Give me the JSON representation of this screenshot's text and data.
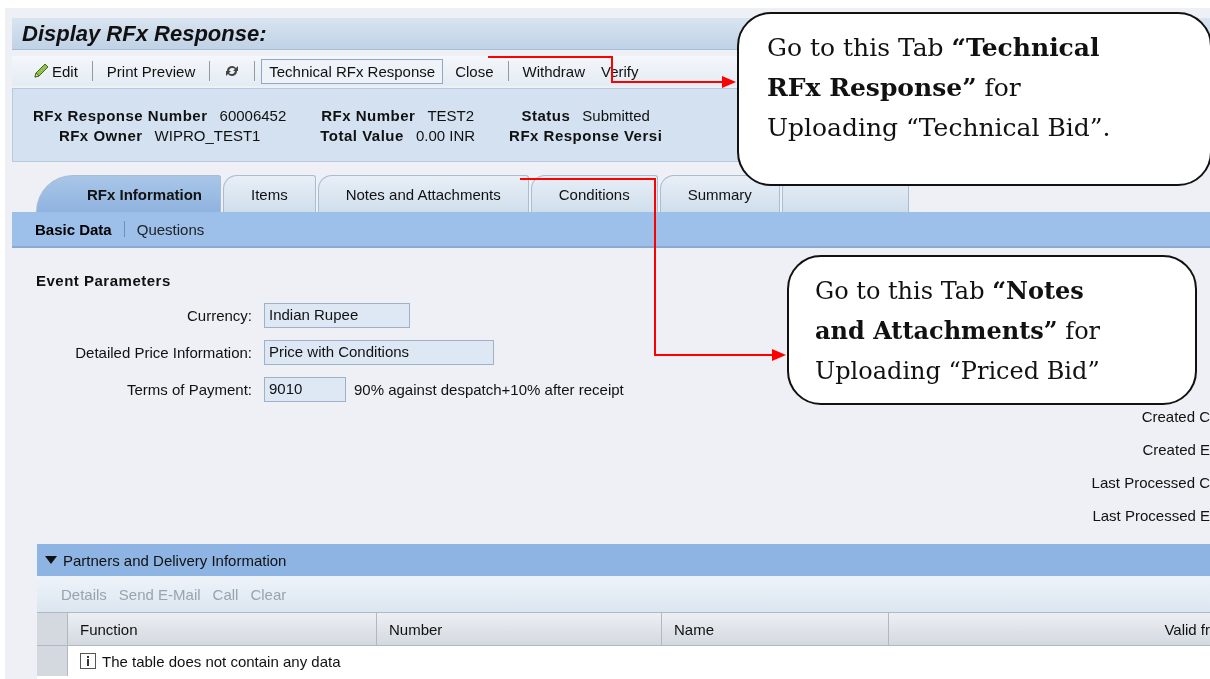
{
  "window": {
    "title": "Display RFx Response:"
  },
  "toolbar": [
    {
      "kind": "edit",
      "label": "Edit",
      "separator_after": true
    },
    {
      "kind": "text",
      "label": "Print Preview",
      "separator_after": true
    },
    {
      "kind": "refresh",
      "separator_after": true
    },
    {
      "kind": "framed",
      "label": "Technical RFx Response",
      "separator_after": false
    },
    {
      "kind": "text",
      "label": "Close",
      "separator_after": true
    },
    {
      "kind": "text",
      "label": "Withdraw",
      "separator_after": false
    },
    {
      "kind": "text",
      "label": "Verify",
      "separator_after": false
    }
  ],
  "header": [
    [
      {
        "label": "RFx Response Number",
        "value": "60006452"
      },
      {
        "label": "RFx Owner",
        "value": "WIPRO_TEST1"
      }
    ],
    [
      {
        "label": "RFx Number",
        "value": "TEST2"
      },
      {
        "label": "Total Value",
        "value": "0.00 INR"
      }
    ],
    [
      {
        "label": "Status",
        "value": "Submitted"
      },
      {
        "label": "RFx Response Versi"
      }
    ]
  ],
  "tabs": [
    {
      "label": "RFx Information",
      "selected": true
    },
    {
      "label": "Items",
      "selected": false
    },
    {
      "label": "Notes and Attachments",
      "selected": false
    },
    {
      "label": "Conditions",
      "selected": false
    },
    {
      "label": "Summary",
      "selected": false
    },
    {
      "selected": false
    }
  ],
  "subtabs": [
    {
      "label": "Basic Data",
      "selected": true
    },
    {
      "label": "Questions",
      "selected": false
    }
  ],
  "event_parameters": {
    "title": "Event Parameters",
    "fields": [
      {
        "label": "Currency:",
        "value": "Indian Rupee"
      },
      {
        "label": "Detailed Price Information:",
        "value": "Price with Conditions"
      },
      {
        "label": "Terms of Payment:",
        "value": "9010",
        "description": "90% against despatch+10% after receipt"
      }
    ]
  },
  "right_labels": [
    "Created C",
    "Created E",
    "Last Processed C",
    "Last Processed E"
  ],
  "partners": {
    "title": "Partners and Delivery Information",
    "expanded": true,
    "actions": [
      {
        "label": "Details",
        "disabled": true
      },
      {
        "label": "Send E-Mail",
        "disabled": true
      },
      {
        "label": "Call",
        "disabled": true
      },
      {
        "label": "Clear",
        "disabled": true
      }
    ],
    "columns": [
      "Function",
      "Number",
      "Name",
      "Valid fr"
    ],
    "empty_message": "The table does not contain any data"
  },
  "callouts": [
    {
      "text": "Go to this Tab **“Technical RFx Response”** for Uploading “Technical Bid”."
    },
    {
      "text": "Go to this Tab **“Notes and Attachments”** for Uploading “Priced Bid”"
    }
  ]
}
